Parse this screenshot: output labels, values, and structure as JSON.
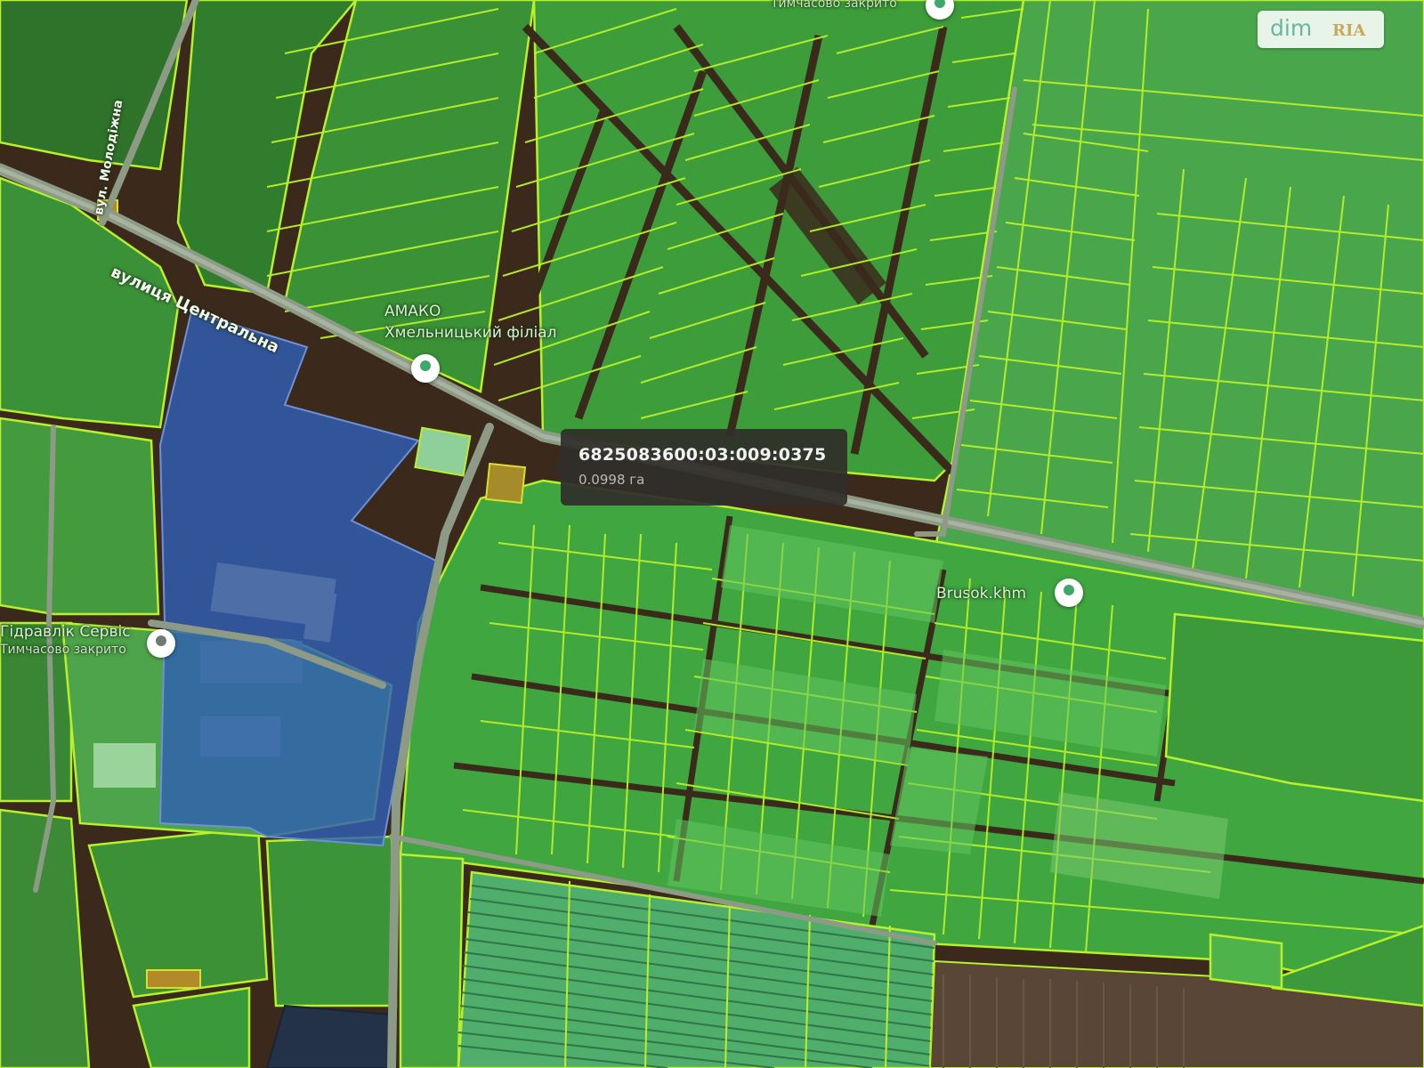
{
  "logo": {
    "part1": "dim",
    "part2": "RIA"
  },
  "tooltip": {
    "cadastral_number": "6825083600:03:009:0375",
    "area": "0.0998 га"
  },
  "streets": {
    "central": "вулиця Центральна",
    "side": "вул. Молодіжна"
  },
  "pois": {
    "amako_name": "АМАКО",
    "amako_sub": "Хмельницький філіал",
    "hydraulic_name": "Гідравлік Сервіс",
    "hydraulic_sub": "Тимчасово закрито",
    "brusok_name": "Brusok.khm",
    "top_sub": "Тимчасово закрито"
  },
  "colors": {
    "parcel_border": "#b8f02a",
    "parcel_fill": "#3fa83f",
    "selected_fill": "#2f5fb3",
    "road": "#8c9a86",
    "tooltip_bg": "#302e2a"
  }
}
